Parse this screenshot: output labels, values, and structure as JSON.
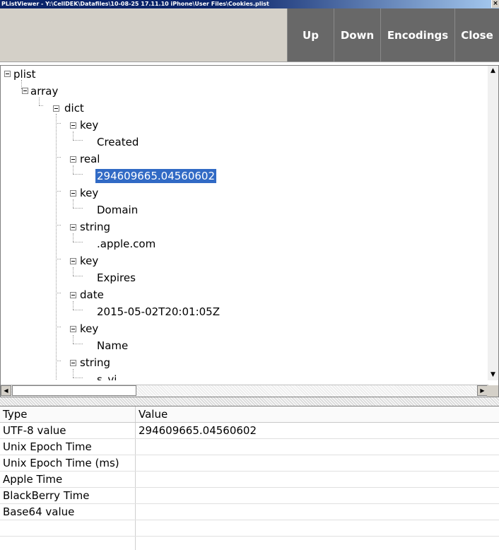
{
  "window": {
    "title": "PListViewer - Y:\\CellDEK\\Datafiles\\10-08-25 17.11.10 iPhone\\User Files\\Cookies.plist",
    "close_glyph": "×"
  },
  "toolbar": {
    "up_label": "Up",
    "down_label": "Down",
    "encodings_label": "Encodings",
    "close_label": "Close"
  },
  "tree": {
    "nodes": [
      {
        "label": "plist"
      },
      {
        "label": "array"
      },
      {
        "label": "dict"
      },
      {
        "label": "key"
      },
      {
        "label": "Created"
      },
      {
        "label": "real"
      },
      {
        "label": "294609665.04560602",
        "selected": true
      },
      {
        "label": "key"
      },
      {
        "label": "Domain"
      },
      {
        "label": "string"
      },
      {
        "label": ".apple.com"
      },
      {
        "label": "key"
      },
      {
        "label": "Expires"
      },
      {
        "label": "date"
      },
      {
        "label": "2015-05-02T20:01:05Z"
      },
      {
        "label": "key"
      },
      {
        "label": "Name"
      },
      {
        "label": "string"
      },
      {
        "label": "s_vi"
      }
    ]
  },
  "grid": {
    "headers": {
      "type": "Type",
      "value": "Value"
    },
    "rows": [
      {
        "type": "UTF-8 value",
        "value": "294609665.04560602"
      },
      {
        "type": "Unix Epoch Time",
        "value": ""
      },
      {
        "type": "Unix Epoch Time (ms)",
        "value": ""
      },
      {
        "type": "Apple Time",
        "value": ""
      },
      {
        "type": "BlackBerry Time",
        "value": ""
      },
      {
        "type": "Base64 value",
        "value": ""
      }
    ]
  },
  "colors": {
    "toolbar_button_bg": "#686868",
    "selection_bg": "#316ac5"
  }
}
